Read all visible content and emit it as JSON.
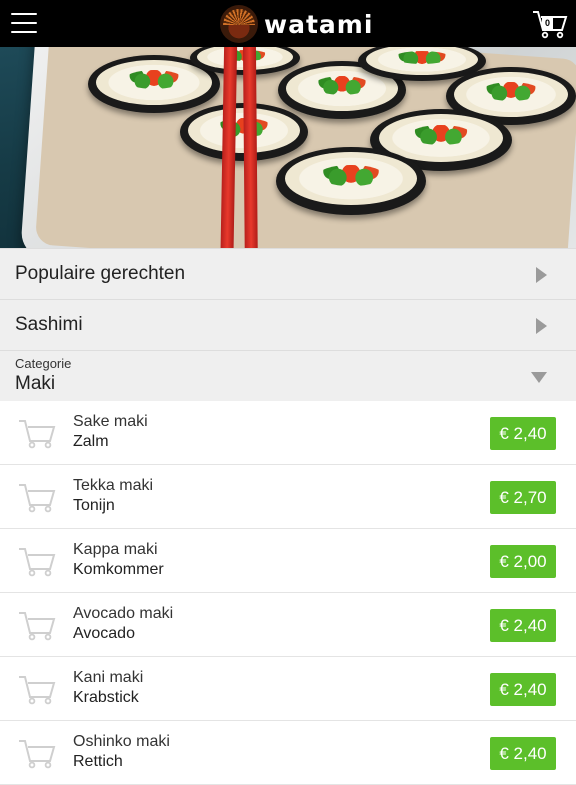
{
  "header": {
    "brand": "watami",
    "cart_count": "0",
    "menu_icon": "hamburger-menu-icon",
    "cart_icon": "shopping-cart-icon"
  },
  "hero": {
    "alt": ""
  },
  "sections": [
    {
      "label": "Populaire gerechten",
      "state": "collapsed"
    },
    {
      "label": "Sashimi",
      "state": "collapsed"
    }
  ],
  "category": {
    "caption": "Categorie",
    "value": "Maki",
    "state": "expanded"
  },
  "items": [
    {
      "name": "Sake maki",
      "desc": "Zalm",
      "price": "€ 2,40"
    },
    {
      "name": "Tekka maki",
      "desc": "Tonijn",
      "price": "€ 2,70"
    },
    {
      "name": "Kappa maki",
      "desc": "Komkommer",
      "price": "€ 2,00"
    },
    {
      "name": "Avocado maki",
      "desc": "Avocado",
      "price": "€ 2,40"
    },
    {
      "name": "Kani maki",
      "desc": "Krabstick",
      "price": "€ 2,40"
    },
    {
      "name": "Oshinko maki",
      "desc": "Rettich",
      "price": "€ 2,40"
    }
  ],
  "colors": {
    "topbar": "#000000",
    "price_button": "#5cbf2a",
    "accordion_bg": "#efefef"
  }
}
